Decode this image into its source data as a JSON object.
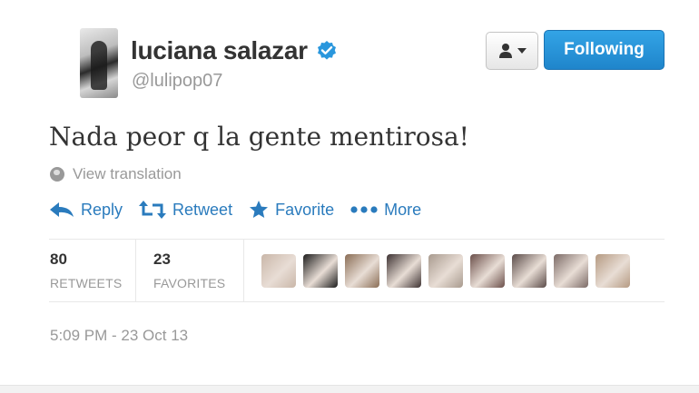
{
  "tweet": {
    "author": {
      "name": "luciana salazar",
      "handle": "@lulipop07",
      "verified": true
    },
    "follow_button": "Following",
    "text": "Nada peor q la gente mentirosa!",
    "view_translation": "View translation",
    "actions": [
      {
        "label": "Reply",
        "icon": "reply-icon"
      },
      {
        "label": "Retweet",
        "icon": "retweet-icon"
      },
      {
        "label": "Favorite",
        "icon": "star-icon"
      },
      {
        "label": "More",
        "icon": "more-dots-icon"
      }
    ],
    "stats": {
      "retweets": {
        "count": "80",
        "label": "RETWEETS"
      },
      "favorites": {
        "count": "23",
        "label": "FAVORITES"
      }
    },
    "favoriter_avatars": [
      {
        "color": "#c9b6a8"
      },
      {
        "color": "#1c1c1c"
      },
      {
        "color": "#8a6d55"
      },
      {
        "color": "#3d3232"
      },
      {
        "color": "#a89a8e"
      },
      {
        "color": "#6b4f4a"
      },
      {
        "color": "#5a4b48"
      },
      {
        "color": "#7b6a66"
      },
      {
        "color": "#b59a82"
      }
    ],
    "timestamp": "5:09 PM - 23 Oct 13"
  },
  "colors": {
    "accent": "#2a7bbd",
    "button_blue": "#2a97dd",
    "muted": "#999999",
    "text": "#333333"
  }
}
